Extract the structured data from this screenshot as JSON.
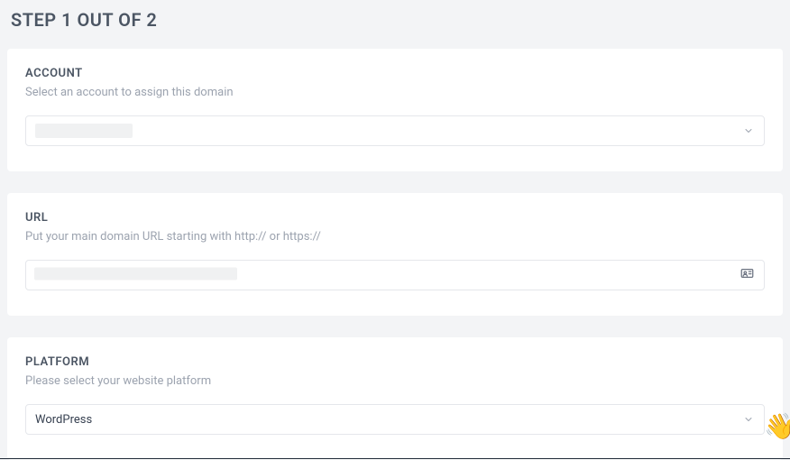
{
  "step": {
    "title": "STEP 1 OUT OF 2"
  },
  "account": {
    "label": "ACCOUNT",
    "description": "Select an account to assign this domain",
    "value": ""
  },
  "url": {
    "label": "URL",
    "description": "Put your main domain URL starting with http:// or https://",
    "value": ""
  },
  "platform": {
    "label": "PLATFORM",
    "description": "Please select your website platform",
    "value": "WordPress"
  },
  "help": {
    "emoji": "👋"
  }
}
